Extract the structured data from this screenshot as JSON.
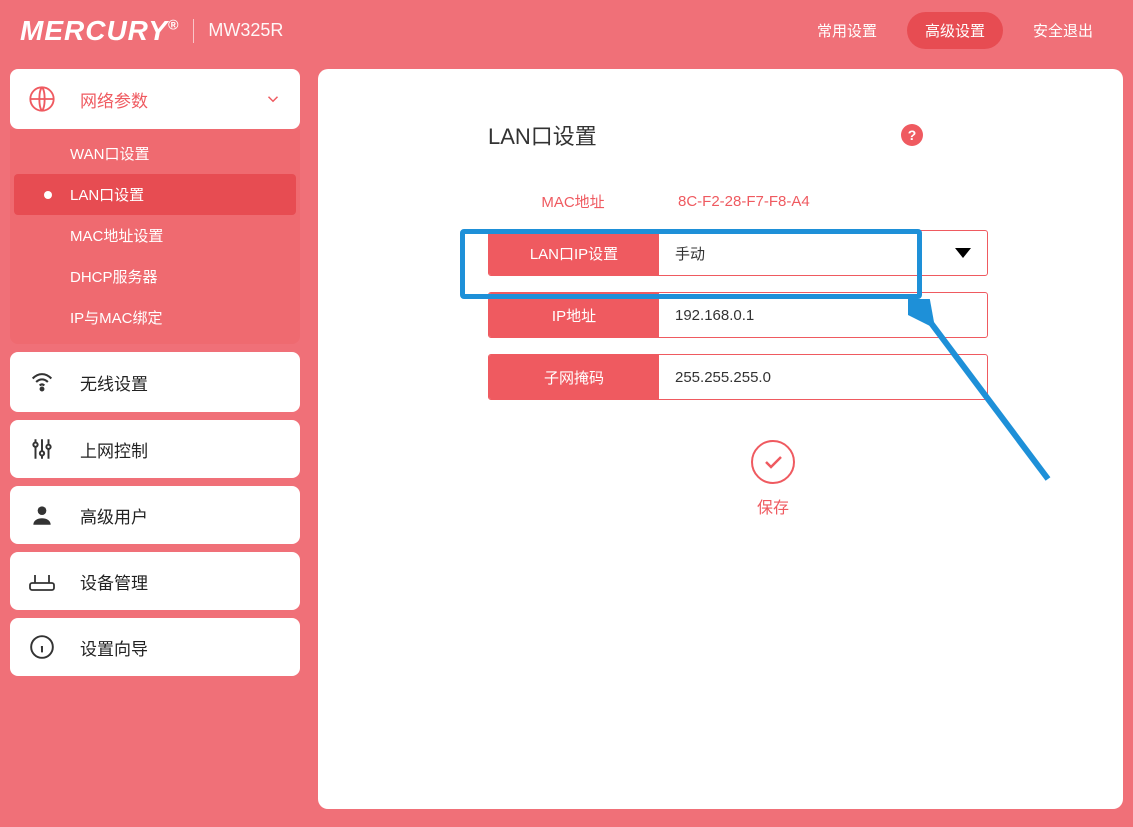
{
  "header": {
    "brand": "MERCURY",
    "model": "MW325R",
    "nav": {
      "common": "常用设置",
      "advanced": "高级设置",
      "logout": "安全退出"
    }
  },
  "sidebar": {
    "network": {
      "label": "网络参数"
    },
    "network_items": {
      "wan": "WAN口设置",
      "lan": "LAN口设置",
      "mac": "MAC地址设置",
      "dhcp": "DHCP服务器",
      "ipmac": "IP与MAC绑定"
    },
    "wireless": "无线设置",
    "access": "上网控制",
    "user": "高级用户",
    "device": "设备管理",
    "wizard": "设置向导"
  },
  "main": {
    "title": "LAN口设置",
    "mac_label": "MAC地址",
    "mac_value": "8C-F2-28-F7-F8-A4",
    "lan_ip_mode_label": "LAN口IP设置",
    "lan_ip_mode_value": "手动",
    "ip_label": "IP地址",
    "ip_value": "192.168.0.1",
    "mask_label": "子网掩码",
    "mask_value": "255.255.255.0",
    "save": "保存"
  }
}
